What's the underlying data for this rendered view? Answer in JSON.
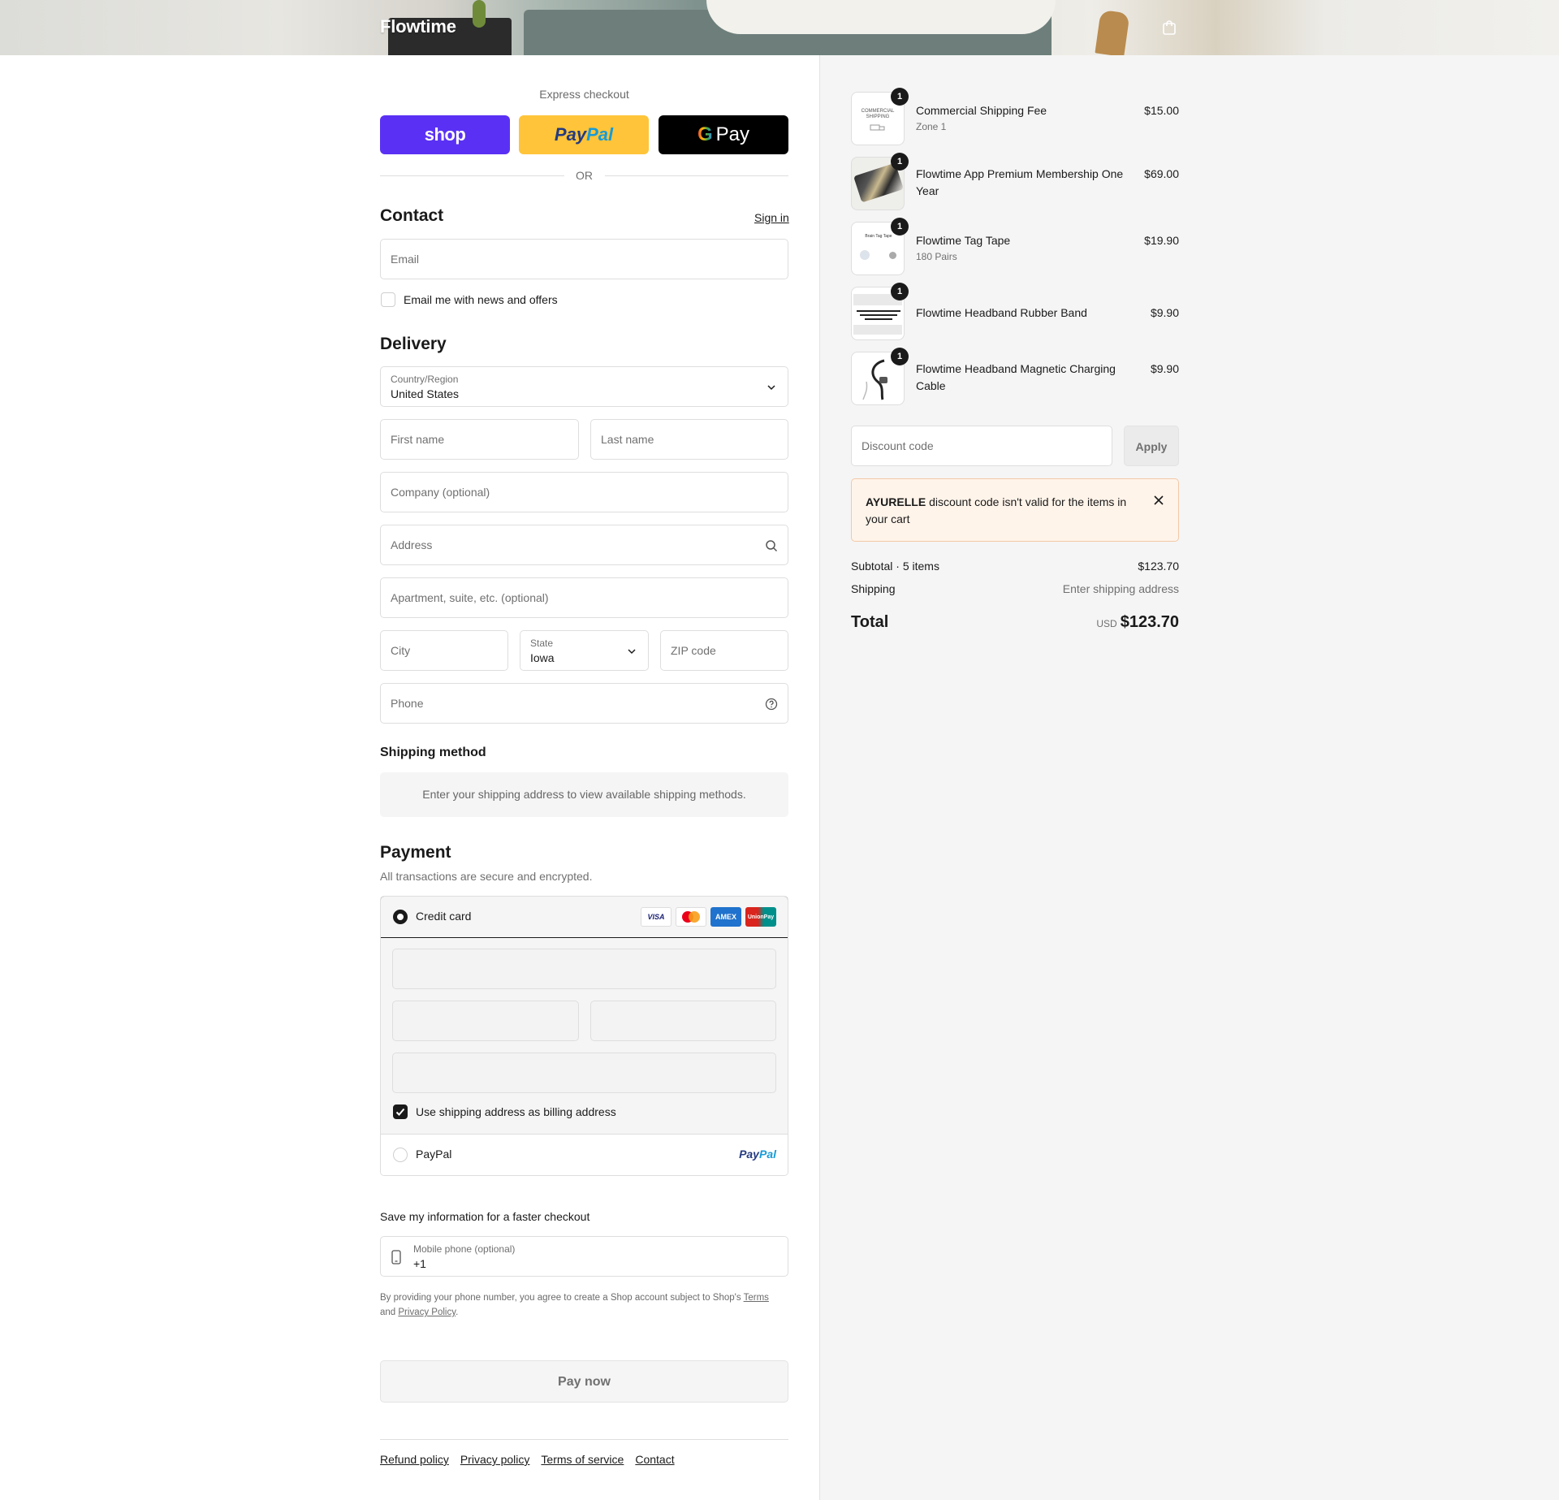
{
  "header": {
    "brand": "Flowtime"
  },
  "express": {
    "title": "Express checkout",
    "shop_label": "shop",
    "paypal_label_a": "Pay",
    "paypal_label_b": "Pal",
    "gpay_g": "G",
    "gpay_label": "Pay",
    "or": "OR"
  },
  "contact": {
    "title": "Contact",
    "sign_in": "Sign in",
    "email_placeholder": "Email",
    "newsletter_label": "Email me with news and offers"
  },
  "delivery": {
    "title": "Delivery",
    "country_label": "Country/Region",
    "country_value": "United States",
    "first_name": "First name",
    "last_name": "Last name",
    "company": "Company (optional)",
    "address": "Address",
    "apartment": "Apartment, suite, etc. (optional)",
    "city": "City",
    "state_label": "State",
    "state_value": "Iowa",
    "zip": "ZIP code",
    "phone": "Phone"
  },
  "shipping_method": {
    "title": "Shipping method",
    "note": "Enter your shipping address to view available shipping methods."
  },
  "payment": {
    "title": "Payment",
    "subtitle": "All transactions are secure and encrypted.",
    "credit_card": "Credit card",
    "cards": [
      "VISA",
      "MC",
      "AMEX",
      "UnionPay"
    ],
    "billing_label": "Use shipping address as billing address",
    "paypal": "PayPal",
    "paypal_logo_a": "Pay",
    "paypal_logo_b": "Pal"
  },
  "save_info": {
    "title": "Save my information for a faster checkout",
    "mobile_label": "Mobile phone (optional)",
    "mobile_value": "+1",
    "legal_text": "By providing your phone number, you agree to create a Shop account subject to Shop's",
    "terms": "Terms",
    "and": "and",
    "privacy": "Privacy Policy",
    "period": "."
  },
  "pay_now": "Pay now",
  "footer": [
    "Refund policy",
    "Privacy policy",
    "Terms of service",
    "Contact"
  ],
  "cart": {
    "items": [
      {
        "name": "Commercial Shipping Fee",
        "variant": "Zone 1",
        "price": "$15.00",
        "qty": "1"
      },
      {
        "name": "Flowtime App Premium Membership One Year",
        "variant": "",
        "price": "$69.00",
        "qty": "1"
      },
      {
        "name": "Flowtime Tag Tape",
        "variant": "180 Pairs",
        "price": "$19.90",
        "qty": "1"
      },
      {
        "name": "Flowtime Headband Rubber Band",
        "variant": "",
        "price": "$9.90",
        "qty": "1"
      },
      {
        "name": "Flowtime Headband Magnetic Charging Cable",
        "variant": "",
        "price": "$9.90",
        "qty": "1"
      }
    ],
    "thumb_text": {
      "shipping_a": "COMMERCIAL",
      "shipping_b": "SHIPPING",
      "tape": "Brain Tag Tape"
    },
    "discount_placeholder": "Discount code",
    "apply": "Apply",
    "alert_code": "AYURELLE",
    "alert_text": "discount code isn't valid for the items in your cart",
    "subtotal_label": "Subtotal · 5 items",
    "subtotal_value": "$123.70",
    "shipping_label": "Shipping",
    "shipping_value": "Enter shipping address",
    "total_label": "Total",
    "currency": "USD",
    "total_value": "$123.70"
  },
  "colors": {
    "shop_purple": "#5a31f4",
    "paypal_yellow": "#ffc439",
    "alert_bg": "#fff4ea",
    "text": "#1a1a1a"
  }
}
